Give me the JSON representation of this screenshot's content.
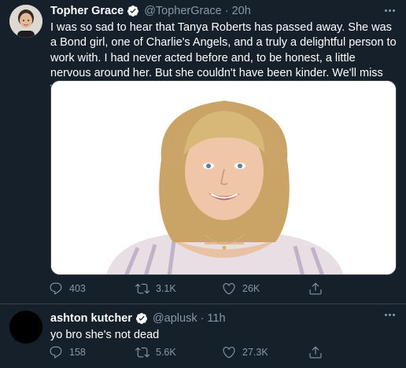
{
  "tweets": [
    {
      "display_name": "Topher Grace",
      "handle": "@TopherGrace",
      "separator": "·",
      "time": "20h",
      "text": "I was so sad to hear that Tanya Roberts has passed away. She was a Bond girl, one of Charlie's Angels, and a truly a delightful person to work with. I had never acted before and, to be honest, a little nervous around her. But she couldn't have been kinder. We'll miss you Midge.",
      "replies": "403",
      "retweets": "3.1K",
      "likes": "26K",
      "verified": true
    },
    {
      "display_name": "ashton kutcher",
      "handle": "@aplusk",
      "separator": "·",
      "time": "11h",
      "text": "yo bro she's not dead",
      "replies": "158",
      "retweets": "5.6K",
      "likes": "27.3K",
      "verified": true
    }
  ],
  "colors": {
    "background": "#15202b",
    "secondary_text": "#8899a6",
    "verified_badge": "#ffffff",
    "divider": "#38444d"
  },
  "icons": [
    "verified-icon",
    "more-icon",
    "reply-icon",
    "retweet-icon",
    "like-icon",
    "share-icon"
  ]
}
